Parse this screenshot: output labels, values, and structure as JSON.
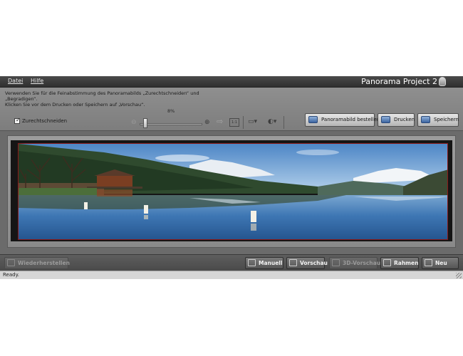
{
  "menu": {
    "file": "Datei",
    "help": "Hilfe"
  },
  "app_title": "Panorama Project 2",
  "instructions": {
    "line1": "Verwenden Sie für die Feinabstimmung des Panoramabilds „Zurechtschneiden“ und",
    "line2": "„Begradigen“.",
    "line3": "Klicken Sie vor dem Drucken oder Speichern auf „Vorschau“."
  },
  "crop": {
    "label": "Zurechtschneiden",
    "checked": true
  },
  "zoom": {
    "percent_label": "8%",
    "value": 0.08,
    "fit_label": "1:1"
  },
  "toolbar_buttons": {
    "order": "Panoramabild bestellen",
    "print": "Drucken",
    "save": "Speichern"
  },
  "bottom_buttons": {
    "restore": "Wiederherstellen",
    "manual": "Manuell",
    "preview": "Vorschau",
    "preview3d": "3D-Vorschau",
    "frame": "Rahmen",
    "new": "Neu"
  },
  "status": "Ready.",
  "icons": {
    "zoom_out": "zoom-out-icon",
    "zoom_in": "zoom-in-icon",
    "arrow": "arrow-right-icon",
    "camera": "camera-icon",
    "lamp": "light-icon"
  }
}
